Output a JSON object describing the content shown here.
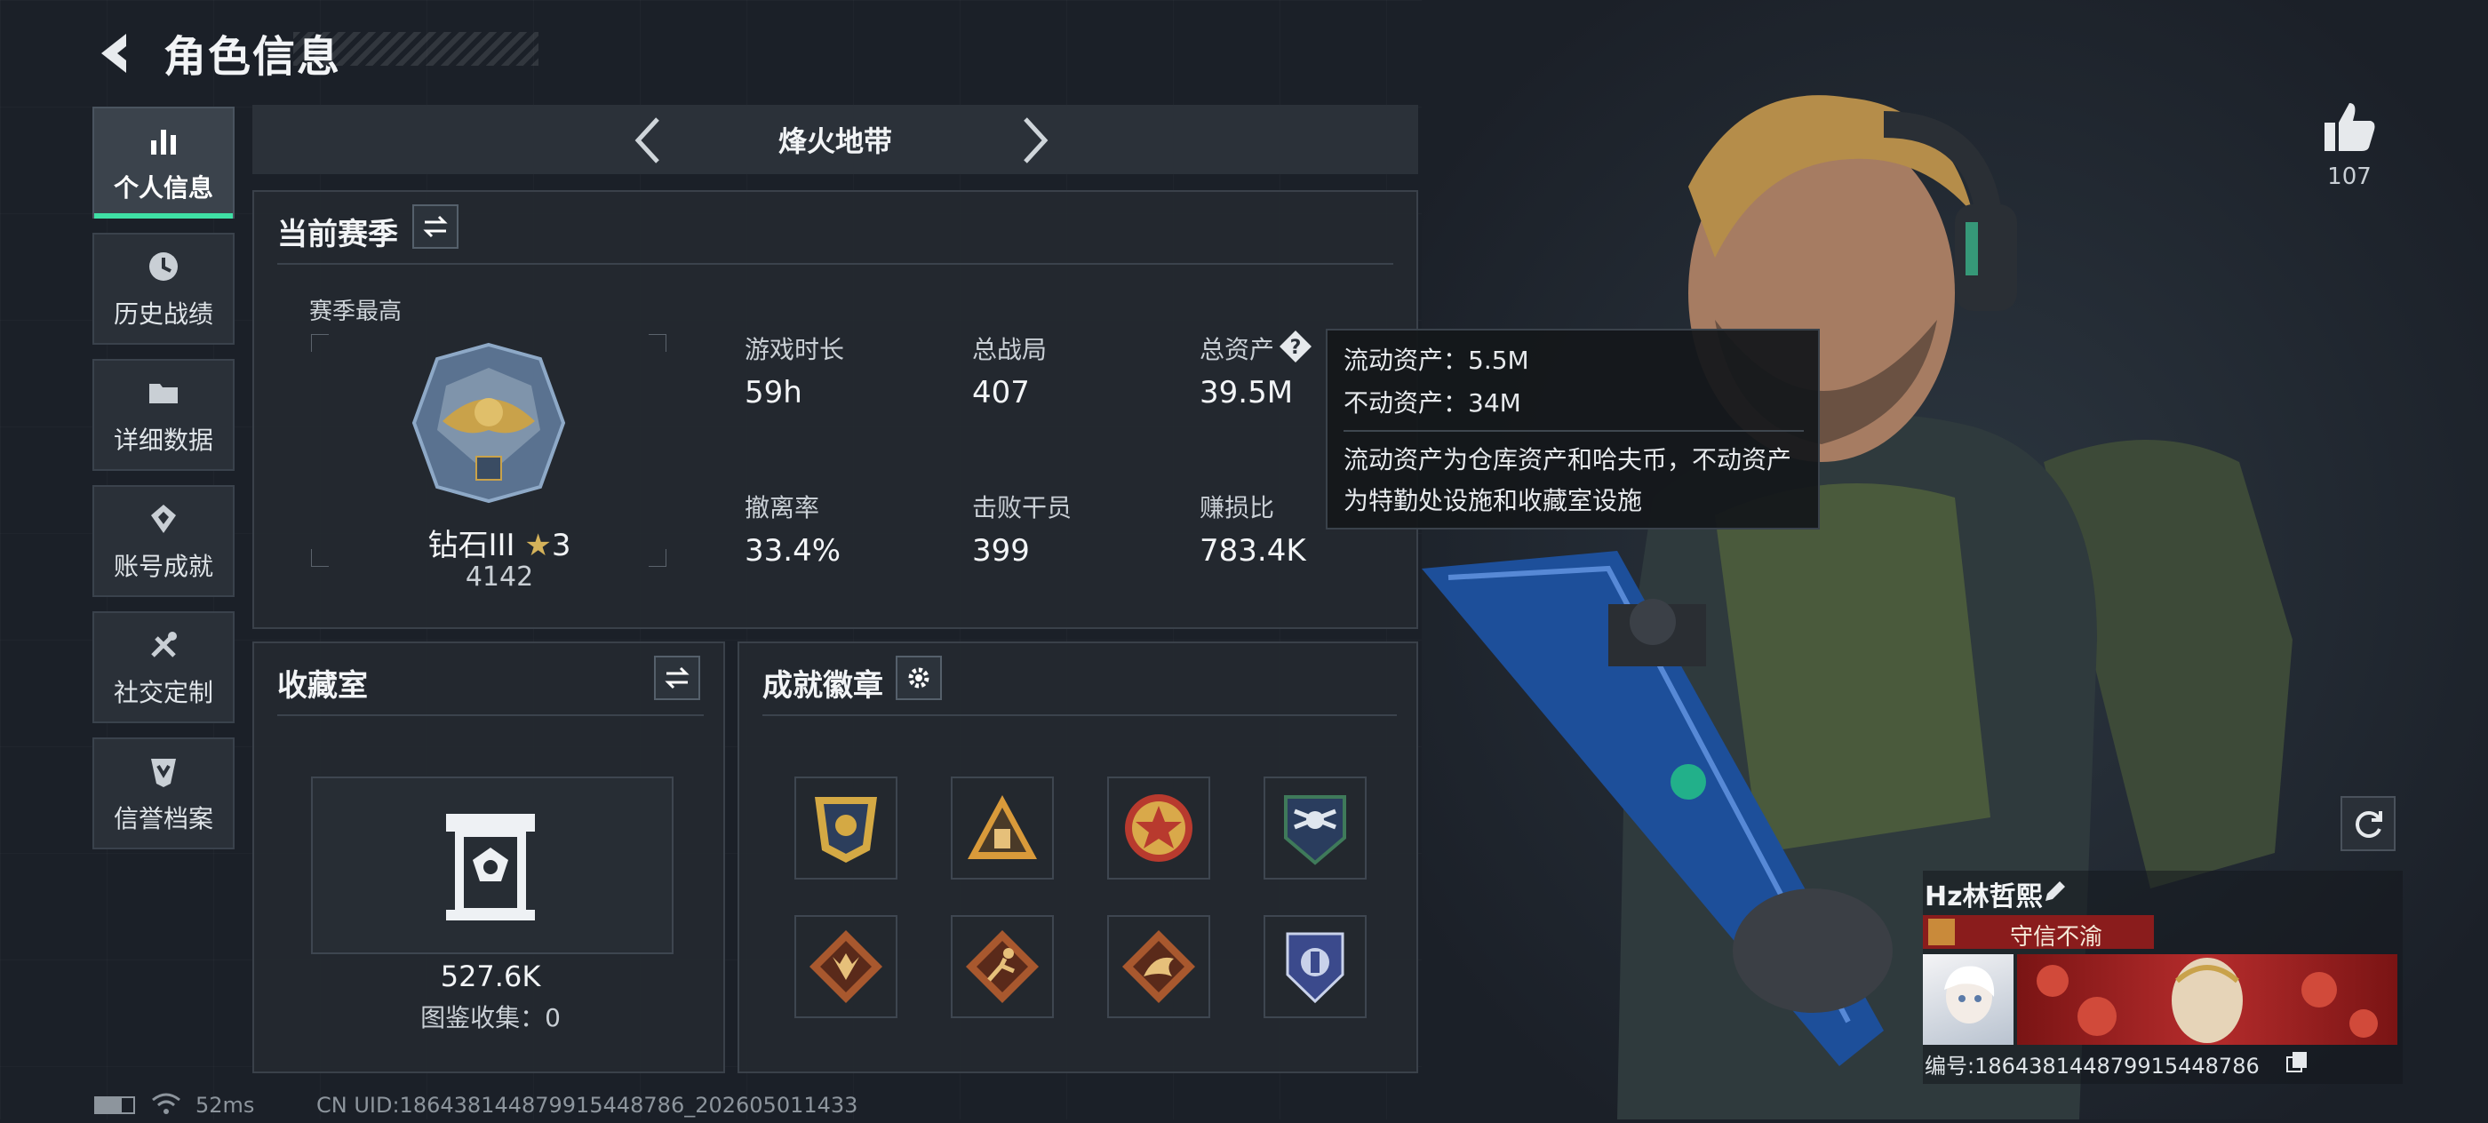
{
  "header": {
    "title": "角色信息"
  },
  "nav": {
    "items": [
      {
        "label": "个人信息",
        "icon": "bar-chart-icon",
        "active": true
      },
      {
        "label": "历史战绩",
        "icon": "clock-icon",
        "active": false
      },
      {
        "label": "详细数据",
        "icon": "folder-icon",
        "active": false
      },
      {
        "label": "账号成就",
        "icon": "achievement-icon",
        "active": false
      },
      {
        "label": "社交定制",
        "icon": "tools-icon",
        "active": false
      },
      {
        "label": "信誉档案",
        "icon": "shield-icon",
        "active": false
      }
    ]
  },
  "mode": {
    "title": "烽火地带"
  },
  "season": {
    "title": "当前赛季",
    "best_label": "赛季最高",
    "rank_name": "钻石III",
    "rank_stars": "3",
    "rank_score": "4142",
    "stats": [
      {
        "label": "游戏时长",
        "value": "59h"
      },
      {
        "label": "总战局",
        "value": "407"
      },
      {
        "label": "总资产",
        "value": "39.5M"
      },
      {
        "label": "撤离率",
        "value": "33.4%"
      },
      {
        "label": "击败干员",
        "value": "399"
      },
      {
        "label": "赚损比",
        "value": "783.4K"
      }
    ]
  },
  "tooltip": {
    "line1": "流动资产：5.5M",
    "line2": "不动资产：34M",
    "desc1": "流动资产为仓库资产和哈夫币，不动资产",
    "desc2": "为特勤处设施和收藏室设施"
  },
  "collection": {
    "title": "收藏室",
    "value": "527.6K",
    "catalog": "图鉴收集：0"
  },
  "badges": {
    "title": "成就徽章",
    "items": [
      "shield-badge-icon",
      "triangle-badge-icon",
      "star-badge-icon",
      "eagle-badge-icon",
      "wolf-badge-icon",
      "runner-badge-icon",
      "dragon-badge-icon",
      "crest-badge-icon"
    ]
  },
  "player": {
    "likes": "107",
    "name": "Hz林哲熙",
    "title": "守信不渝",
    "id": "编号:1864381448799154487​86"
  },
  "status": {
    "ping": "52ms",
    "uid": "CN UID:186438144879915448786_202605011433"
  },
  "colors": {
    "accent": "#3fe0a5",
    "title_badge": "#8a1c1c"
  }
}
